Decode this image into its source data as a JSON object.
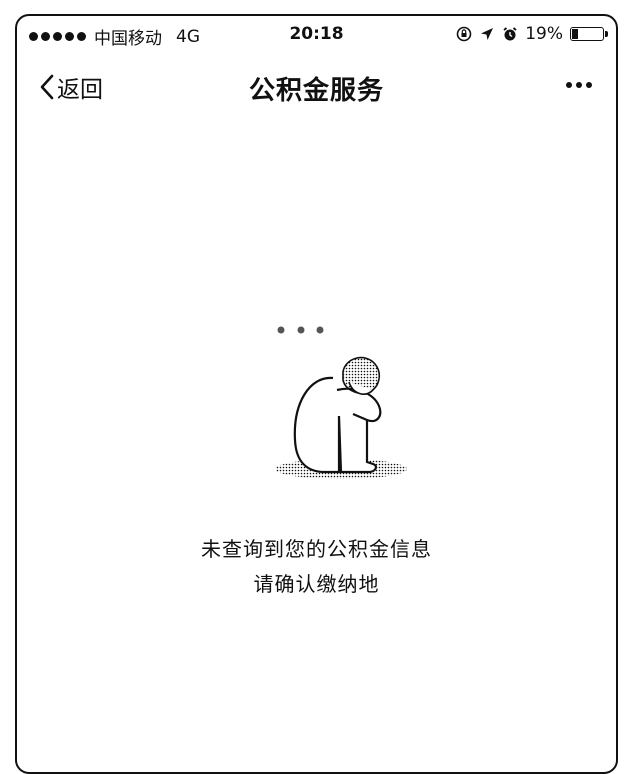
{
  "status_bar": {
    "carrier": "中国移动",
    "network": "4G",
    "time": "20:18",
    "battery": "19%",
    "battery_level": 0.19
  },
  "nav": {
    "back_label": "返回",
    "title": "公积金服务"
  },
  "empty_state": {
    "line1": "未查询到您的公积金信息",
    "line2": "请确认缴纳地"
  },
  "icons": {
    "back": "chevron-left-icon",
    "more": "more-dots-icon",
    "lock": "orientation-lock-icon",
    "location": "location-arrow-icon",
    "alarm": "alarm-icon",
    "battery": "battery-icon",
    "illustration": "sad-person-illustration"
  }
}
